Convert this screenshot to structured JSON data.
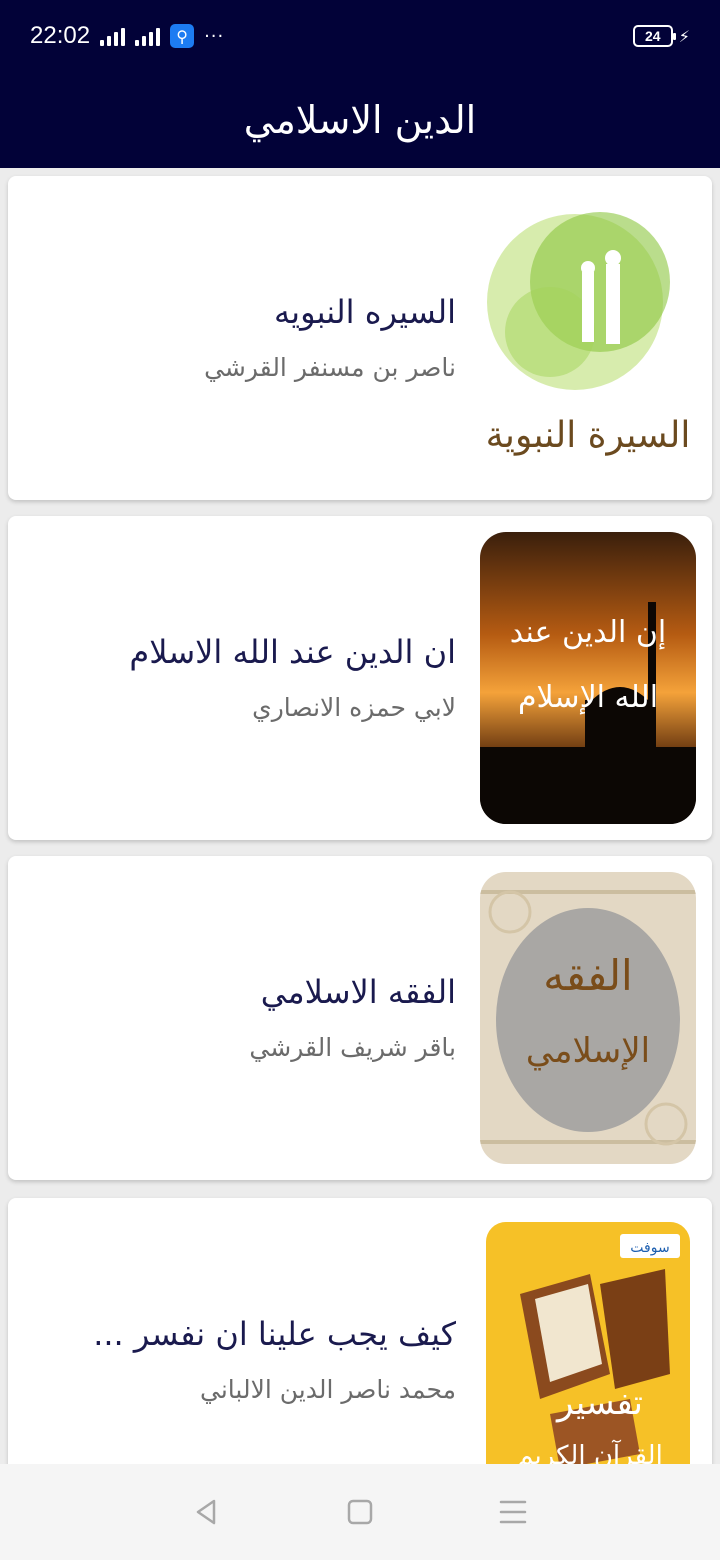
{
  "status_bar": {
    "time": "22:02",
    "battery": "24",
    "overflow": "···"
  },
  "app_bar": {
    "title": "الدين الاسلامي"
  },
  "items": [
    {
      "title": "السيره النبويه",
      "author": "ناصر بن مسنفر القرشي",
      "thumb_text": "السيرة النبوية"
    },
    {
      "title": "ان الدين عند الله الاسلام",
      "author": "لابي حمزه الانصاري",
      "thumb_text_line1": "إن الدين عند",
      "thumb_text_line2": "الله الإسلام"
    },
    {
      "title": "الفقه الاسلامي",
      "author": "باقر شريف القرشي",
      "thumb_text_line1": "الفقه",
      "thumb_text_line2": "الإسلامي"
    },
    {
      "title": "كيف يجب علينا ان نفسر ...",
      "author": "محمد ناصر الدين الالباني",
      "thumb_text_line1": "تفسير",
      "thumb_text_line2": "القرآن الكريم",
      "thumb_badge": "سوفت"
    }
  ],
  "colors": {
    "primary": "#020238",
    "title_text": "#1a1a4e",
    "subtitle_text": "#6b6b6b"
  }
}
